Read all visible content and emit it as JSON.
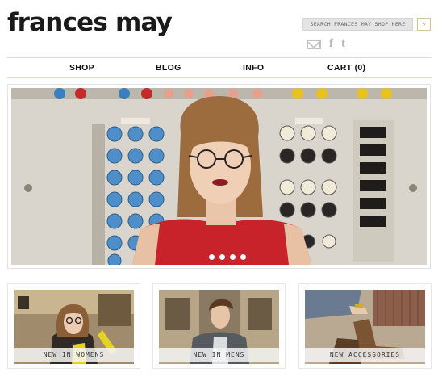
{
  "brand": {
    "logo_text": "frances may"
  },
  "search": {
    "placeholder": "SEARCH FRANCES MAY SHOP HERE",
    "submit_label": "»"
  },
  "social": {
    "icons": [
      "mail-icon",
      "facebook-icon",
      "twitter-icon"
    ],
    "facebook_glyph": "f",
    "twitter_glyph": "t"
  },
  "nav": {
    "shop": "SHOP",
    "blog": "BLOG",
    "info": "INFO",
    "cart": "CART (0)"
  },
  "hero": {
    "slide_count": 4
  },
  "tiles": [
    {
      "label": "NEW IN WOMENS"
    },
    {
      "label": "NEW IN MENS"
    },
    {
      "label": "NEW ACCESSORIES"
    }
  ],
  "colors": {
    "accent_gold": "#c9a865",
    "nav_rule": "#eadbb8",
    "dress_red": "#c8222a"
  }
}
